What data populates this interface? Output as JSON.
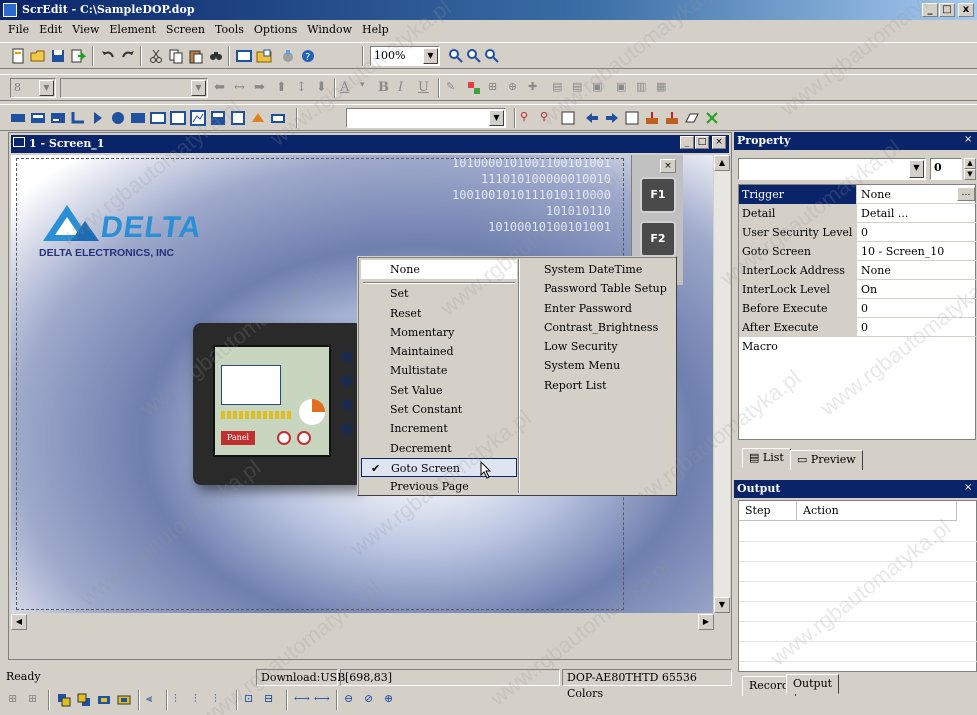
{
  "window": {
    "title": "ScrEdit - C:\\SampleDOP.dop",
    "controls": [
      "_",
      "□",
      "x"
    ]
  },
  "menubar": [
    "File",
    "Edit",
    "View",
    "Element",
    "Screen",
    "Tools",
    "Options",
    "Window",
    "Help"
  ],
  "toolbar": {
    "zoom_value": "100%",
    "font_size_value": "8"
  },
  "screen_window": {
    "title": "1 - Screen_1",
    "logo_text": "DELTA",
    "logo_subtitle": "DELTA ELECTRONICS, INC",
    "binary_lines": [
      "1010000101001100101001",
      "111010100000010010",
      "1001001010111010110000",
      "101010110",
      "10100010100101001"
    ],
    "fkeys": [
      "F1",
      "F2"
    ],
    "device_button_label": "Panel"
  },
  "context_menu": {
    "left_items": [
      {
        "label": "None"
      },
      {
        "label": "Set"
      },
      {
        "label": "Reset"
      },
      {
        "label": "Momentary"
      },
      {
        "label": "Maintained"
      },
      {
        "label": "Multistate"
      },
      {
        "label": "Set Value"
      },
      {
        "label": "Set Constant"
      },
      {
        "label": "Increment"
      },
      {
        "label": "Decrement"
      },
      {
        "label": "Goto Screen",
        "checked": true
      },
      {
        "label": "Previous Page"
      }
    ],
    "right_items": [
      "System DateTime",
      "Password Table Setup",
      "Enter Password",
      "Contrast_Brightness",
      "Low Security",
      "System Menu",
      "Report List"
    ]
  },
  "property_panel": {
    "title": "Property",
    "spin_value": "0",
    "rows": [
      {
        "key": "Trigger",
        "value": "None"
      },
      {
        "key": "Detail",
        "value": "Detail ..."
      },
      {
        "key": "User Security Level",
        "value": "0"
      },
      {
        "key": "Goto Screen",
        "value": "10 - Screen_10"
      },
      {
        "key": "InterLock Address",
        "value": "None"
      },
      {
        "key": "InterLock Level",
        "value": "On"
      },
      {
        "key": "Before Execute Macro",
        "value": "0"
      },
      {
        "key": "After Execute Macro",
        "value": "0"
      }
    ],
    "tabs": [
      "List",
      "Preview"
    ]
  },
  "output_panel": {
    "title": "Output",
    "columns": [
      "Step",
      "Action"
    ],
    "tabs": [
      "Record",
      "Output"
    ]
  },
  "statusbar": {
    "status": "Ready",
    "download": "Download:USB",
    "coords": "[698,83]",
    "model": "DOP-AE80THTD 65536 Colors"
  },
  "colors": {
    "title_bar": "#0a246a",
    "window_face": "#d4d0c8",
    "delta_blue": "#2a8fd4"
  },
  "watermark": "www.rgbautomatyka.pl"
}
